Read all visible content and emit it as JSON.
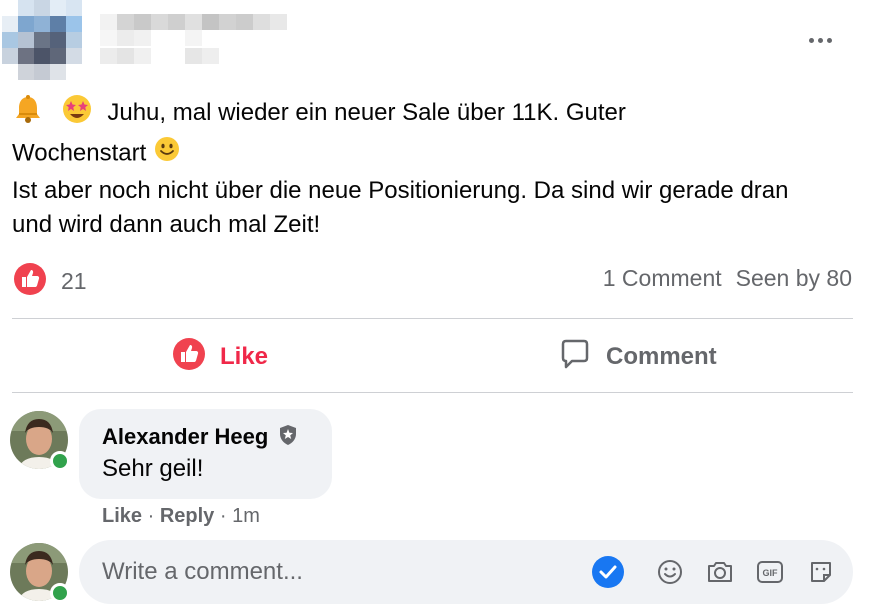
{
  "post": {
    "line1_text": "Juhu, mal wieder ein neuer Sale über 11K. Guter",
    "line1b_text": "Wochenstart",
    "paragraph2": "Ist aber noch nicht über die neue Positionierung. Da sind wir gerade dran und wird dann auch mal Zeit!"
  },
  "reactions": {
    "count": "21",
    "comments_label": "1 Comment",
    "seen_label": "Seen by 80"
  },
  "actions": {
    "like_label": "Like",
    "comment_label": "Comment"
  },
  "comment": {
    "author": "Alexander Heeg",
    "text": "Sehr geil!",
    "like_label": "Like",
    "sep1": "·",
    "reply_label": "Reply",
    "sep2": "·",
    "time": "1m"
  },
  "composer": {
    "placeholder": "Write a comment..."
  },
  "icons": {
    "bell": "bell-icon",
    "star_eyes": "star-struck-emoji-icon",
    "smile": "smiling-face-emoji-icon",
    "like_reaction": "thumbs-up-reaction-icon",
    "comment": "speech-bubble-icon",
    "verified": "shield-badge-icon",
    "checkmark": "checkmark-icon",
    "emoji": "emoji-icon",
    "camera": "camera-icon",
    "gif": "gif-icon",
    "sticker": "sticker-icon",
    "more": "more-options-icon"
  },
  "colors": {
    "like_red": "#f02849",
    "secondary_text": "#65676b",
    "online_green": "#31a24c",
    "check_blue": "#1877f2",
    "bubble_bg": "#f0f2f5"
  }
}
